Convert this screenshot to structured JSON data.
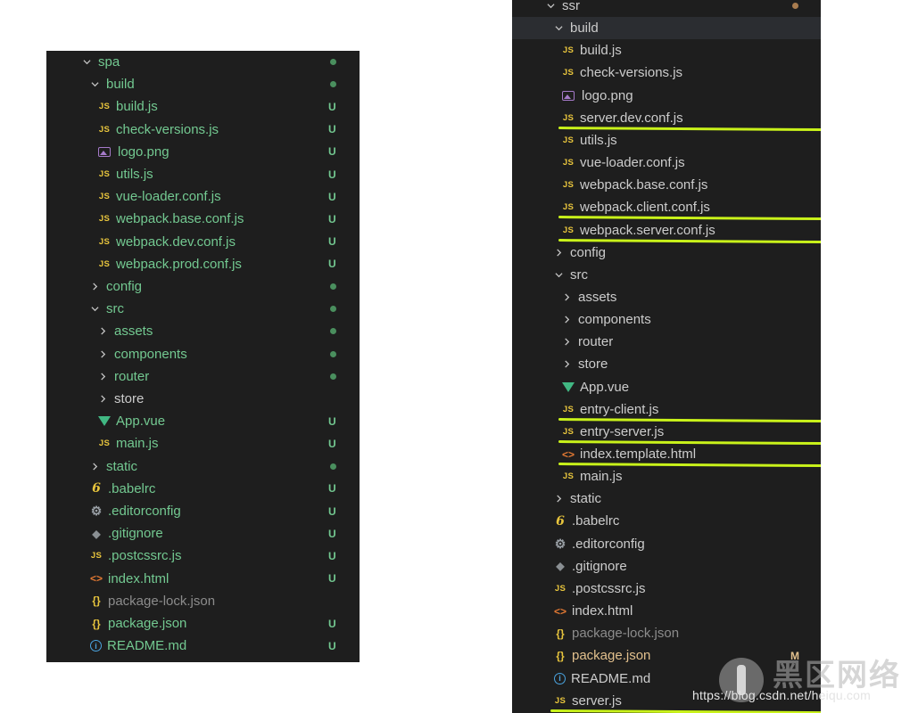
{
  "colors": {
    "panel_bg": "#1e1e1e",
    "untracked_green": "#73c991",
    "modified_yellow": "#e2c08d",
    "default_text": "#cccccc",
    "ignored_gray": "#8c8c8c",
    "highlight_underline": "#c9f21a",
    "folder_dot": "#4a8f5e"
  },
  "left_tree": {
    "root": "spa",
    "items": [
      {
        "label": "spa",
        "kind": "folder",
        "open": true,
        "depth": 0,
        "color": "#73c991",
        "dot": true
      },
      {
        "label": "build",
        "kind": "folder",
        "open": true,
        "depth": 1,
        "color": "#73c991",
        "dot": true
      },
      {
        "label": "build.js",
        "kind": "js",
        "depth": 2,
        "color": "#73c991",
        "badge": "U"
      },
      {
        "label": "check-versions.js",
        "kind": "js",
        "depth": 2,
        "color": "#73c991",
        "badge": "U"
      },
      {
        "label": "logo.png",
        "kind": "png",
        "depth": 2,
        "color": "#73c991",
        "badge": "U"
      },
      {
        "label": "utils.js",
        "kind": "js",
        "depth": 2,
        "color": "#73c991",
        "badge": "U"
      },
      {
        "label": "vue-loader.conf.js",
        "kind": "js",
        "depth": 2,
        "color": "#73c991",
        "badge": "U"
      },
      {
        "label": "webpack.base.conf.js",
        "kind": "js",
        "depth": 2,
        "color": "#73c991",
        "badge": "U"
      },
      {
        "label": "webpack.dev.conf.js",
        "kind": "js",
        "depth": 2,
        "color": "#73c991",
        "badge": "U"
      },
      {
        "label": "webpack.prod.conf.js",
        "kind": "js",
        "depth": 2,
        "color": "#73c991",
        "badge": "U"
      },
      {
        "label": "config",
        "kind": "folder",
        "open": false,
        "depth": 1,
        "color": "#73c991",
        "dot": true
      },
      {
        "label": "src",
        "kind": "folder",
        "open": true,
        "depth": 1,
        "color": "#73c991",
        "dot": true
      },
      {
        "label": "assets",
        "kind": "folder",
        "open": false,
        "depth": 2,
        "color": "#73c991",
        "dot": true
      },
      {
        "label": "components",
        "kind": "folder",
        "open": false,
        "depth": 2,
        "color": "#73c991",
        "dot": true
      },
      {
        "label": "router",
        "kind": "folder",
        "open": false,
        "depth": 2,
        "color": "#73c991",
        "dot": true
      },
      {
        "label": "store",
        "kind": "folder",
        "open": false,
        "depth": 2,
        "color": "#cccccc"
      },
      {
        "label": "App.vue",
        "kind": "vue",
        "depth": 2,
        "color": "#73c991",
        "badge": "U"
      },
      {
        "label": "main.js",
        "kind": "js",
        "depth": 2,
        "color": "#73c991",
        "badge": "U"
      },
      {
        "label": "static",
        "kind": "folder",
        "open": false,
        "depth": 1,
        "color": "#73c991",
        "dot": true
      },
      {
        "label": ".babelrc",
        "kind": "babel",
        "depth": 1,
        "color": "#73c991",
        "badge": "U"
      },
      {
        "label": ".editorconfig",
        "kind": "gear",
        "depth": 1,
        "color": "#73c991",
        "badge": "U"
      },
      {
        "label": ".gitignore",
        "kind": "git",
        "depth": 1,
        "color": "#73c991",
        "badge": "U"
      },
      {
        "label": ".postcssrc.js",
        "kind": "js",
        "depth": 1,
        "color": "#73c991",
        "badge": "U"
      },
      {
        "label": "index.html",
        "kind": "html",
        "depth": 1,
        "color": "#73c991",
        "badge": "U"
      },
      {
        "label": "package-lock.json",
        "kind": "json",
        "depth": 1,
        "color": "#8c8c8c"
      },
      {
        "label": "package.json",
        "kind": "json",
        "depth": 1,
        "color": "#73c991",
        "badge": "U"
      },
      {
        "label": "README.md",
        "kind": "info",
        "depth": 1,
        "color": "#73c991",
        "badge": "U"
      }
    ]
  },
  "right_tree": {
    "root": "ssr",
    "items": [
      {
        "label": "ssr",
        "kind": "folder",
        "open": true,
        "depth": 0,
        "color": "#cccccc",
        "dot": true,
        "dot_color": "#a87c4f"
      },
      {
        "label": "build",
        "kind": "folder",
        "open": true,
        "depth": 1,
        "color": "#cccccc",
        "active": true
      },
      {
        "label": "build.js",
        "kind": "js",
        "depth": 2,
        "color": "#cccccc"
      },
      {
        "label": "check-versions.js",
        "kind": "js",
        "depth": 2,
        "color": "#cccccc"
      },
      {
        "label": "logo.png",
        "kind": "png",
        "depth": 2,
        "color": "#cccccc"
      },
      {
        "label": "server.dev.conf.js",
        "kind": "js",
        "depth": 2,
        "color": "#cccccc",
        "underline": true
      },
      {
        "label": "utils.js",
        "kind": "js",
        "depth": 2,
        "color": "#cccccc"
      },
      {
        "label": "vue-loader.conf.js",
        "kind": "js",
        "depth": 2,
        "color": "#cccccc"
      },
      {
        "label": "webpack.base.conf.js",
        "kind": "js",
        "depth": 2,
        "color": "#cccccc"
      },
      {
        "label": "webpack.client.conf.js",
        "kind": "js",
        "depth": 2,
        "color": "#cccccc",
        "underline": true
      },
      {
        "label": "webpack.server.conf.js",
        "kind": "js",
        "depth": 2,
        "color": "#cccccc",
        "underline": true
      },
      {
        "label": "config",
        "kind": "folder",
        "open": false,
        "depth": 1,
        "color": "#cccccc"
      },
      {
        "label": "src",
        "kind": "folder",
        "open": true,
        "depth": 1,
        "color": "#cccccc"
      },
      {
        "label": "assets",
        "kind": "folder",
        "open": false,
        "depth": 2,
        "color": "#cccccc"
      },
      {
        "label": "components",
        "kind": "folder",
        "open": false,
        "depth": 2,
        "color": "#cccccc"
      },
      {
        "label": "router",
        "kind": "folder",
        "open": false,
        "depth": 2,
        "color": "#cccccc"
      },
      {
        "label": "store",
        "kind": "folder",
        "open": false,
        "depth": 2,
        "color": "#cccccc"
      },
      {
        "label": "App.vue",
        "kind": "vue",
        "depth": 2,
        "color": "#cccccc"
      },
      {
        "label": "entry-client.js",
        "kind": "js",
        "depth": 2,
        "color": "#cccccc",
        "underline": true
      },
      {
        "label": "entry-server.js",
        "kind": "js",
        "depth": 2,
        "color": "#cccccc",
        "underline": true
      },
      {
        "label": "index.template.html",
        "kind": "html",
        "depth": 2,
        "color": "#cccccc",
        "underline": true
      },
      {
        "label": "main.js",
        "kind": "js",
        "depth": 2,
        "color": "#cccccc"
      },
      {
        "label": "static",
        "kind": "folder",
        "open": false,
        "depth": 1,
        "color": "#cccccc"
      },
      {
        "label": ".babelrc",
        "kind": "babel",
        "depth": 1,
        "color": "#cccccc"
      },
      {
        "label": ".editorconfig",
        "kind": "gear",
        "depth": 1,
        "color": "#cccccc"
      },
      {
        "label": ".gitignore",
        "kind": "git",
        "depth": 1,
        "color": "#cccccc"
      },
      {
        "label": ".postcssrc.js",
        "kind": "js",
        "depth": 1,
        "color": "#cccccc"
      },
      {
        "label": "index.html",
        "kind": "html",
        "depth": 1,
        "color": "#cccccc"
      },
      {
        "label": "package-lock.json",
        "kind": "json",
        "depth": 1,
        "color": "#8c8c8c"
      },
      {
        "label": "package.json",
        "kind": "json",
        "depth": 1,
        "color": "#e2c08d",
        "badge": "M"
      },
      {
        "label": "README.md",
        "kind": "info",
        "depth": 1,
        "color": "#cccccc"
      },
      {
        "label": "server.js",
        "kind": "js",
        "depth": 1,
        "color": "#cccccc",
        "underline": true
      }
    ]
  },
  "watermark": {
    "url": "https://blog.csdn.net/heiqu.com",
    "brand": "黑区网络"
  }
}
